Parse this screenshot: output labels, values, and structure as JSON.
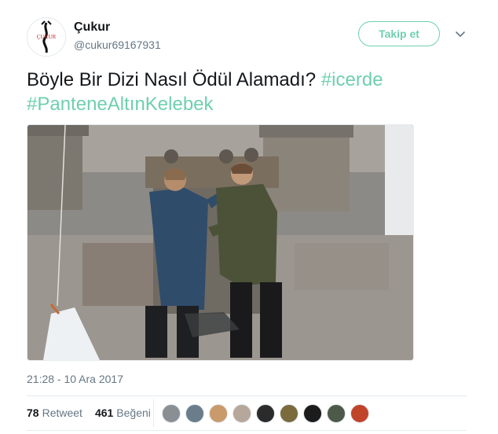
{
  "author": {
    "name": "Çukur",
    "handle": "@cukur69167931",
    "avatar_logo_text": "ÇUKUR"
  },
  "follow_button": {
    "label": "Takip et"
  },
  "tweet": {
    "text": "Böyle Bir Dizi Nasıl Ödül Alamadı?",
    "hashtags": [
      "#icerde",
      "#PanteneAltınKelebek"
    ]
  },
  "timestamp": "21:28 - 10 Ara 2017",
  "stats": {
    "retweets": {
      "count": "78",
      "label": "Retweet"
    },
    "likes": {
      "count": "461",
      "label": "Beğeni"
    }
  },
  "likers": [
    {
      "color": "#8a8f94"
    },
    {
      "color": "#6b7c8a"
    },
    {
      "color": "#c99a6b"
    },
    {
      "color": "#b5a79a"
    },
    {
      "color": "#2b2b2b"
    },
    {
      "color": "#7a6a3c"
    },
    {
      "color": "#1c1c1c"
    },
    {
      "color": "#4d5a4a"
    },
    {
      "color": "#c0442a"
    }
  ],
  "colors": {
    "accent": "#6fcfb0",
    "text_primary": "#14171a",
    "text_secondary": "#657786",
    "border": "#e6ecf0"
  }
}
